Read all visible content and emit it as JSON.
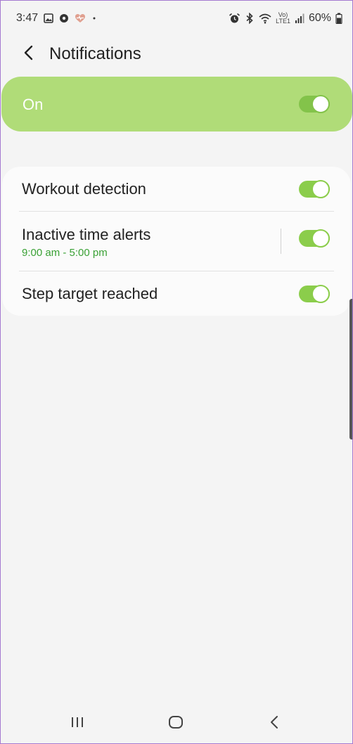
{
  "status_bar": {
    "time": "3:47",
    "battery_percent": "60%",
    "network_label_top": "Vo)",
    "network_label_bottom": "LTE1",
    "left_icons": [
      "image-icon",
      "record-icon",
      "heart-rate-icon",
      "dot-icon"
    ],
    "right_icons": [
      "alarm-icon",
      "bluetooth-icon",
      "wifi-icon",
      "signal-icon",
      "battery-icon"
    ]
  },
  "header": {
    "title": "Notifications",
    "back_icon": "chevron-left-icon"
  },
  "master_switch": {
    "label": "On",
    "checked": true
  },
  "settings": [
    {
      "title": "Workout detection",
      "checked": true
    },
    {
      "title": "Inactive time alerts",
      "subtitle": "9:00 am - 5:00 pm",
      "checked": true
    },
    {
      "title": "Step target reached",
      "checked": true
    }
  ],
  "nav_bar": {
    "icons": [
      "recents-icon",
      "home-icon",
      "back-icon"
    ]
  },
  "colors": {
    "accent": "#8bcd4b",
    "master_card": "#b0dc78",
    "subtitle": "#3aa135",
    "background": "#f4f4f4"
  }
}
